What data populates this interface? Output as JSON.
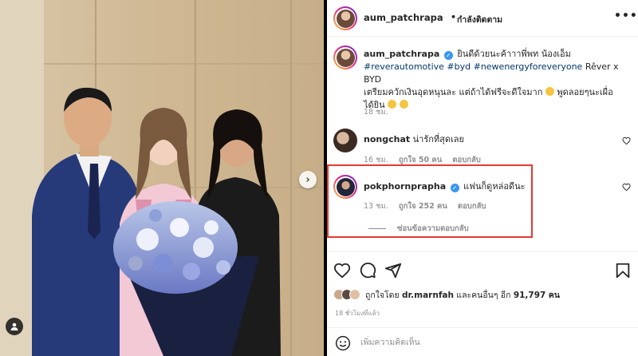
{
  "post": {
    "username": "aum_patchrapa",
    "follow_label": "กำลังติดตาม",
    "more_label": "•••",
    "caption": {
      "username": "aum_patchrapa",
      "text1": "ยินดีด้วยนะค้าาาพี่พท น้องเอ็ม",
      "hashtags": "#reverautomotive #byd #newenergyforeveryone",
      "text2": "Rêver x BYD",
      "text3": "เตรียมควักเงินอุดหนุนละ แต่ถ้าได้ฟรีจะดีใจมาก",
      "text4": "พูดลอยๆนะเผื่อได้ยิน",
      "time": "18 ชม."
    }
  },
  "comments": [
    {
      "username": "nongchat",
      "verified": false,
      "text": "น่ารักที่สุดเลย",
      "time": "16 ชม.",
      "likes": "ถูกใจ 50 คน",
      "reply_label": "ตอบกลับ"
    },
    {
      "username": "pokphornprapha",
      "verified": true,
      "text": "แฟนก็ดูหล่อดีนะ",
      "time": "13 ชม.",
      "likes": "ถูกใจ 252 คน",
      "reply_label": "ตอบกลับ",
      "hide_replies": "ซ่อนข้อความตอบกลับ"
    }
  ],
  "likes_summary": {
    "prefix": "ถูกใจโดย",
    "user": "dr.marnfah",
    "mid": "และคนอื่นๆ อีก",
    "count": "91,797",
    "suffix": "คน"
  },
  "post_time": "18 ชั่วโมงที่แล้ว",
  "comment_placeholder": "เพิ่มความคิดเห็น",
  "colors": {
    "link": "#00376b",
    "verified": "#3897f0",
    "highlight": "#e53935",
    "muted": "#8e8e8e"
  }
}
